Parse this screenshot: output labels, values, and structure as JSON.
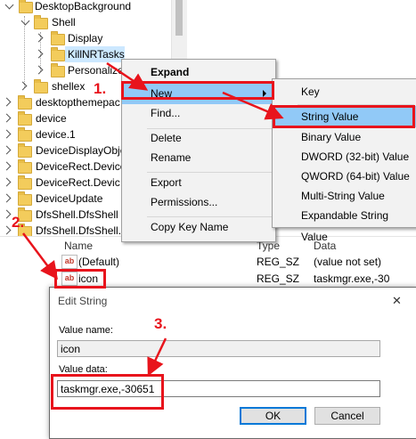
{
  "tree": {
    "items": [
      {
        "label": "DesktopBackground",
        "expanded": true
      },
      {
        "label": "Shell",
        "expanded": true
      },
      {
        "label": "Display"
      },
      {
        "label": "KillNRTasks",
        "selected": true
      },
      {
        "label": "Personalize"
      },
      {
        "label": "shellex"
      },
      {
        "label": "desktopthemepac"
      },
      {
        "label": "device"
      },
      {
        "label": "device.1"
      },
      {
        "label": "DeviceDisplayObje"
      },
      {
        "label": "DeviceRect.Device"
      },
      {
        "label": "DeviceRect.Devic"
      },
      {
        "label": "DeviceUpdate"
      },
      {
        "label": "DfsShell.DfsShell"
      },
      {
        "label": "DfsShell.DfsShell.1"
      }
    ]
  },
  "context_menu": {
    "items": [
      {
        "label": "Expand",
        "bold": true
      },
      {
        "label": "New",
        "has_submenu": true,
        "highlighted": true
      },
      {
        "label": "Find..."
      },
      {
        "label": "Delete"
      },
      {
        "label": "Rename"
      },
      {
        "label": "Export"
      },
      {
        "label": "Permissions..."
      },
      {
        "label": "Copy Key Name"
      }
    ]
  },
  "submenu": {
    "items": [
      {
        "label": "Key"
      },
      {
        "label": "String Value",
        "highlighted": true
      },
      {
        "label": "Binary Value"
      },
      {
        "label": "DWORD (32-bit) Value"
      },
      {
        "label": "QWORD (64-bit) Value"
      },
      {
        "label": "Multi-String Value"
      },
      {
        "label": "Expandable String Value"
      }
    ]
  },
  "value_list": {
    "columns": {
      "name": "Name",
      "type": "Type",
      "data": "Data"
    },
    "rows": [
      {
        "icon": "ab",
        "name": "(Default)",
        "type": "REG_SZ",
        "data": "(value not set)"
      },
      {
        "icon": "ab",
        "name": "icon",
        "type": "REG_SZ",
        "data": "taskmgr.exe,-30"
      }
    ]
  },
  "dialog": {
    "title": "Edit String",
    "value_name_label": "Value name:",
    "value_name": "icon",
    "value_data_label": "Value data:",
    "value_data": "taskmgr.exe,-30651",
    "ok_label": "OK",
    "cancel_label": "Cancel",
    "close_glyph": "✕"
  },
  "annotations": {
    "step1": "1.",
    "step2": "2.",
    "step3": "3."
  },
  "colors": {
    "annotation_red": "#e8141c",
    "menu_highlight": "#91c9f7",
    "tree_selection": "#cce8ff",
    "folder": "#f3cc5c"
  }
}
